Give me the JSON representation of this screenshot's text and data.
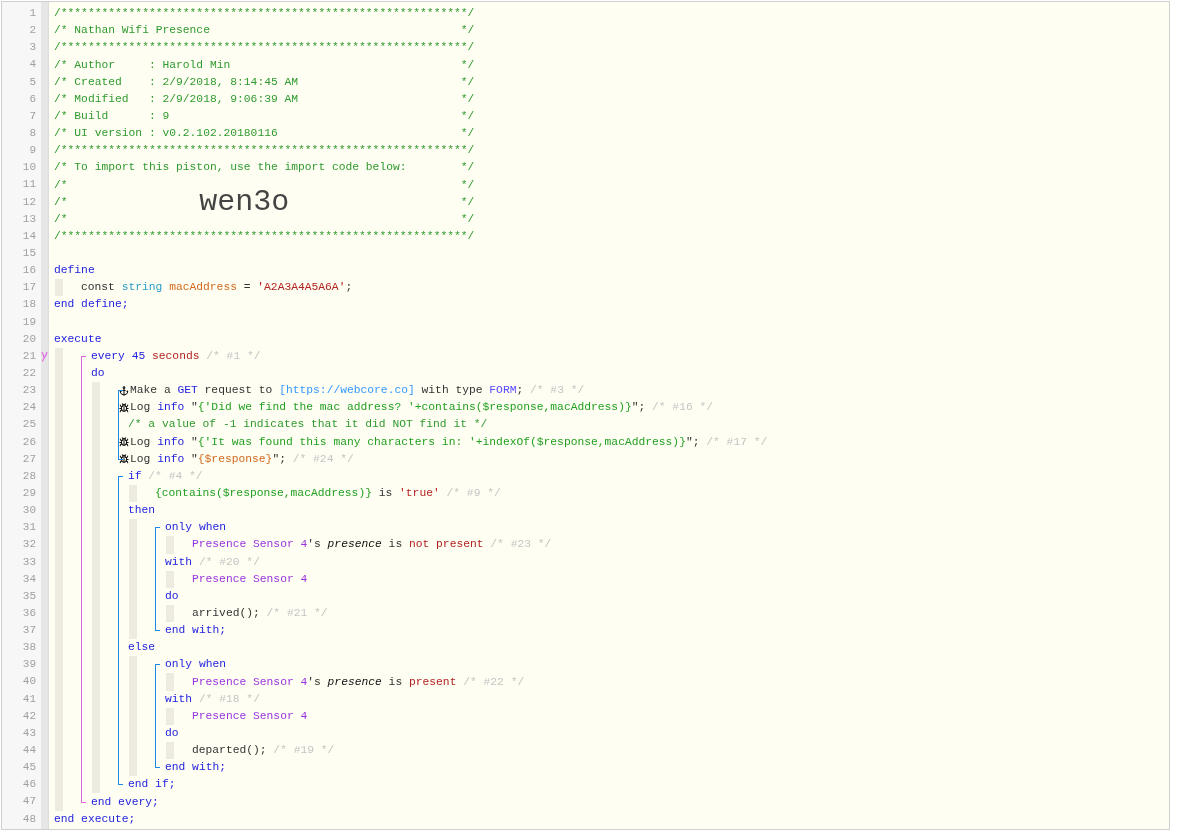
{
  "editor": {
    "lines": [
      {
        "kind": "line",
        "number": "1",
        "marked": false,
        "tokens": [
          {
            "text": "/************************************************************/",
            "kind": "comment"
          }
        ]
      },
      {
        "kind": "line",
        "number": "2",
        "marked": false,
        "tokens": [
          {
            "text": "/* Nathan Wifi Presence",
            "kind": "comment"
          },
          {
            "text": "*/",
            "kind": "comment_close"
          }
        ]
      },
      {
        "kind": "line",
        "number": "3",
        "marked": false,
        "tokens": [
          {
            "text": "/************************************************************/",
            "kind": "comment"
          }
        ]
      },
      {
        "kind": "line",
        "number": "4",
        "marked": false,
        "tokens": [
          {
            "text": "/* Author     : Harold Min",
            "kind": "comment"
          },
          {
            "text": "*/",
            "kind": "comment_close"
          }
        ]
      },
      {
        "kind": "line",
        "number": "5",
        "marked": false,
        "tokens": [
          {
            "text": "/* Created    : 2/9/2018, 8:14:45 AM",
            "kind": "comment"
          },
          {
            "text": "*/",
            "kind": "comment_close"
          }
        ]
      },
      {
        "kind": "line",
        "number": "6",
        "marked": false,
        "tokens": [
          {
            "text": "/* Modified   : 2/9/2018, 9:06:39 AM",
            "kind": "comment"
          },
          {
            "text": "*/",
            "kind": "comment_close"
          }
        ]
      },
      {
        "kind": "line",
        "number": "7",
        "marked": false,
        "tokens": [
          {
            "text": "/* Build      : 9",
            "kind": "comment"
          },
          {
            "text": "*/",
            "kind": "comment_close"
          }
        ]
      },
      {
        "kind": "line",
        "number": "8",
        "marked": false,
        "tokens": [
          {
            "text": "/* UI version : v0.2.102.20180116",
            "kind": "comment"
          },
          {
            "text": "*/",
            "kind": "comment_close"
          }
        ]
      },
      {
        "kind": "line",
        "number": "9",
        "marked": false,
        "tokens": [
          {
            "text": "/************************************************************/",
            "kind": "comment"
          }
        ]
      },
      {
        "kind": "line",
        "number": "10",
        "marked": false,
        "tokens": [
          {
            "text": "/* To import this piston, use the import code below:",
            "kind": "comment"
          },
          {
            "text": "*/",
            "kind": "comment_close"
          }
        ]
      },
      {
        "kind": "line",
        "number": "11",
        "marked": false,
        "tokens": [
          {
            "text": "/*",
            "kind": "comment"
          },
          {
            "text": "*/",
            "kind": "comment_close"
          }
        ]
      },
      {
        "kind": "line",
        "number": "12",
        "marked": false,
        "tokens": [
          {
            "text": "/*",
            "kind": "comment"
          },
          {
            "text": "wen3o",
            "kind": "import_code"
          },
          {
            "text": "*/",
            "kind": "comment_close"
          }
        ]
      },
      {
        "kind": "line",
        "number": "13",
        "marked": false,
        "tokens": [
          {
            "text": "/*",
            "kind": "comment"
          },
          {
            "text": "*/",
            "kind": "comment_close"
          }
        ]
      },
      {
        "kind": "line",
        "number": "14",
        "marked": false,
        "tokens": [
          {
            "text": "/************************************************************/",
            "kind": "comment"
          }
        ]
      },
      {
        "kind": "line",
        "number": "15",
        "marked": false
      },
      {
        "kind": "line",
        "number": "16",
        "marked": false,
        "tokens": [
          {
            "text": "define",
            "kind": "keyword"
          }
        ],
        "children": [
          {
            "kind": "line",
            "number": "17",
            "marked": false,
            "tokens": [
              {
                "text": "const ",
                "kind": "plain"
              },
              {
                "text": "string ",
                "kind": "type"
              },
              {
                "text": "macAddress",
                "kind": "variable"
              },
              {
                "text": " = ",
                "kind": "plain"
              },
              {
                "text": "'A2A3A4A5A6A'",
                "kind": "string"
              },
              {
                "text": ";",
                "kind": "plain"
              }
            ]
          }
        ]
      },
      {
        "kind": "line",
        "number": "18",
        "marked": false,
        "tokens": [
          {
            "text": "end define;",
            "kind": "keyword"
          }
        ]
      },
      {
        "kind": "line",
        "number": "19",
        "marked": false
      },
      {
        "kind": "line",
        "number": "20",
        "marked": false,
        "tokens": [
          {
            "text": "execute",
            "kind": "keyword"
          }
        ],
        "children": [
          {
            "kind": "block",
            "color": "#dd66dd",
            "lines": [
              {
                "kind": "line",
                "number": "21",
                "marked": true,
                "tokens": [
                  {
                    "text": "every ",
                    "kind": "keyword"
                  },
                  {
                    "text": "45 ",
                    "kind": "number"
                  },
                  {
                    "text": "seconds ",
                    "kind": "unit"
                  },
                  {
                    "text": "/* #1 */",
                    "kind": "note"
                  }
                ]
              },
              {
                "kind": "line",
                "number": "22",
                "marked": false,
                "tokens": [
                  {
                    "text": "do",
                    "kind": "keyword"
                  }
                ],
                "children": [
                  {
                    "kind": "block",
                    "color": "#1e88e5",
                    "lines": [
                      {
                        "kind": "request",
                        "number": "23",
                        "marked": false,
                        "tokens": [
                          {
                            "text": "Make a ",
                            "kind": "plain"
                          },
                          {
                            "text": "GET",
                            "kind": "keyword"
                          },
                          {
                            "text": " request to ",
                            "kind": "plain"
                          },
                          {
                            "text": "[https://webcore.co]",
                            "kind": "link"
                          },
                          {
                            "text": " with type ",
                            "kind": "plain"
                          },
                          {
                            "text": "FORM",
                            "kind": "option"
                          },
                          {
                            "text": "; ",
                            "kind": "plain"
                          },
                          {
                            "text": "/* #3 */",
                            "kind": "note"
                          }
                        ]
                      },
                      {
                        "kind": "log",
                        "number": "24",
                        "marked": false,
                        "tokens": [
                          {
                            "text": "Log ",
                            "kind": "plain"
                          },
                          {
                            "text": "info ",
                            "kind": "keyword"
                          },
                          {
                            "text": "\"",
                            "kind": "plain"
                          },
                          {
                            "text": "{'Did we find the mac address? '+contains($response,macAddress)}",
                            "kind": "expression"
                          },
                          {
                            "text": "\"; ",
                            "kind": "plain"
                          },
                          {
                            "text": "/* #16 */",
                            "kind": "note"
                          }
                        ]
                      },
                      {
                        "kind": "line",
                        "number": "25",
                        "marked": false,
                        "tokens": [
                          {
                            "text": "/* a value of -1 indicates that it did NOT find it */",
                            "kind": "comment"
                          }
                        ]
                      },
                      {
                        "kind": "log",
                        "number": "26",
                        "marked": false,
                        "tokens": [
                          {
                            "text": "Log ",
                            "kind": "plain"
                          },
                          {
                            "text": "info ",
                            "kind": "keyword"
                          },
                          {
                            "text": "\"",
                            "kind": "plain"
                          },
                          {
                            "text": "{'It was found this many characters in: '+indexOf($response,macAddress)}",
                            "kind": "expression"
                          },
                          {
                            "text": "\"; ",
                            "kind": "plain"
                          },
                          {
                            "text": "/* #17 */",
                            "kind": "note"
                          }
                        ]
                      },
                      {
                        "kind": "log",
                        "number": "27",
                        "marked": false,
                        "tokens": [
                          {
                            "text": "Log ",
                            "kind": "plain"
                          },
                          {
                            "text": "info ",
                            "kind": "keyword"
                          },
                          {
                            "text": "\"",
                            "kind": "plain"
                          },
                          {
                            "text": "{$response}",
                            "kind": "variable"
                          },
                          {
                            "text": "\"; ",
                            "kind": "plain"
                          },
                          {
                            "text": "/* #24 */",
                            "kind": "note"
                          }
                        ]
                      }
                    ]
                  },
                  {
                    "kind": "block",
                    "color": "#1e88e5",
                    "lines": [
                      {
                        "kind": "line",
                        "number": "28",
                        "marked": false,
                        "tokens": [
                          {
                            "text": "if ",
                            "kind": "keyword"
                          },
                          {
                            "text": "/* #4 */",
                            "kind": "note"
                          }
                        ],
                        "children": [
                          {
                            "kind": "line",
                            "number": "29",
                            "marked": false,
                            "tokens": [
                              {
                                "text": "{contains($response,macAddress)}",
                                "kind": "expression"
                              },
                              {
                                "text": " is ",
                                "kind": "plain"
                              },
                              {
                                "text": "'true' ",
                                "kind": "string"
                              },
                              {
                                "text": "/* #9 */",
                                "kind": "note"
                              }
                            ]
                          }
                        ]
                      },
                      {
                        "kind": "line",
                        "number": "30",
                        "marked": false,
                        "tokens": [
                          {
                            "text": "then",
                            "kind": "keyword"
                          }
                        ],
                        "children": [
                          {
                            "kind": "block",
                            "color": "#1e88e5",
                            "lines": [
                              {
                                "kind": "line",
                                "number": "31",
                                "marked": false,
                                "tokens": [
                                  {
                                    "text": "only when",
                                    "kind": "keyword"
                                  }
                                ],
                                "children": [
                                  {
                                    "kind": "line",
                                    "number": "32",
                                    "marked": false,
                                    "tokens": [
                                      {
                                        "text": "Presence Sensor 4",
                                        "kind": "device"
                                      },
                                      {
                                        "text": "'s ",
                                        "kind": "plain"
                                      },
                                      {
                                        "text": "presence",
                                        "kind": "attribute"
                                      },
                                      {
                                        "text": " is ",
                                        "kind": "plain"
                                      },
                                      {
                                        "text": "not present ",
                                        "kind": "string"
                                      },
                                      {
                                        "text": "/* #23 */",
                                        "kind": "note"
                                      }
                                    ]
                                  }
                                ]
                              },
                              {
                                "kind": "line",
                                "number": "33",
                                "marked": false,
                                "tokens": [
                                  {
                                    "text": "with ",
                                    "kind": "keyword"
                                  },
                                  {
                                    "text": "/* #20 */",
                                    "kind": "note"
                                  }
                                ],
                                "children": [
                                  {
                                    "kind": "line",
                                    "number": "34",
                                    "marked": false,
                                    "tokens": [
                                      {
                                        "text": "Presence Sensor 4",
                                        "kind": "device"
                                      }
                                    ]
                                  }
                                ]
                              },
                              {
                                "kind": "line",
                                "number": "35",
                                "marked": false,
                                "tokens": [
                                  {
                                    "text": "do",
                                    "kind": "keyword"
                                  }
                                ],
                                "children": [
                                  {
                                    "kind": "line",
                                    "number": "36",
                                    "marked": false,
                                    "tokens": [
                                      {
                                        "text": "arrived(); ",
                                        "kind": "plain"
                                      },
                                      {
                                        "text": "/* #21 */",
                                        "kind": "note"
                                      }
                                    ]
                                  }
                                ]
                              },
                              {
                                "kind": "line",
                                "number": "37",
                                "marked": false,
                                "tokens": [
                                  {
                                    "text": "end with;",
                                    "kind": "keyword"
                                  }
                                ]
                              }
                            ]
                          }
                        ]
                      },
                      {
                        "kind": "line",
                        "number": "38",
                        "marked": false,
                        "tokens": [
                          {
                            "text": "else",
                            "kind": "keyword"
                          }
                        ],
                        "children": [
                          {
                            "kind": "block",
                            "color": "#1e88e5",
                            "lines": [
                              {
                                "kind": "line",
                                "number": "39",
                                "marked": false,
                                "tokens": [
                                  {
                                    "text": "only when",
                                    "kind": "keyword"
                                  }
                                ],
                                "children": [
                                  {
                                    "kind": "line",
                                    "number": "40",
                                    "marked": false,
                                    "tokens": [
                                      {
                                        "text": "Presence Sensor 4",
                                        "kind": "device"
                                      },
                                      {
                                        "text": "'s ",
                                        "kind": "plain"
                                      },
                                      {
                                        "text": "presence",
                                        "kind": "attribute"
                                      },
                                      {
                                        "text": " is ",
                                        "kind": "plain"
                                      },
                                      {
                                        "text": "present ",
                                        "kind": "string"
                                      },
                                      {
                                        "text": "/* #22 */",
                                        "kind": "note"
                                      }
                                    ]
                                  }
                                ]
                              },
                              {
                                "kind": "line",
                                "number": "41",
                                "marked": false,
                                "tokens": [
                                  {
                                    "text": "with ",
                                    "kind": "keyword"
                                  },
                                  {
                                    "text": "/* #18 */",
                                    "kind": "note"
                                  }
                                ],
                                "children": [
                                  {
                                    "kind": "line",
                                    "number": "42",
                                    "marked": false,
                                    "tokens": [
                                      {
                                        "text": "Presence Sensor 4",
                                        "kind": "device"
                                      }
                                    ]
                                  }
                                ]
                              },
                              {
                                "kind": "line",
                                "number": "43",
                                "marked": false,
                                "tokens": [
                                  {
                                    "text": "do",
                                    "kind": "keyword"
                                  }
                                ],
                                "children": [
                                  {
                                    "kind": "line",
                                    "number": "44",
                                    "marked": false,
                                    "tokens": [
                                      {
                                        "text": "departed(); ",
                                        "kind": "plain"
                                      },
                                      {
                                        "text": "/* #19 */",
                                        "kind": "note"
                                      }
                                    ]
                                  }
                                ]
                              },
                              {
                                "kind": "line",
                                "number": "45",
                                "marked": false,
                                "tokens": [
                                  {
                                    "text": "end with;",
                                    "kind": "keyword"
                                  }
                                ]
                              }
                            ]
                          }
                        ]
                      },
                      {
                        "kind": "line",
                        "number": "46",
                        "marked": false,
                        "tokens": [
                          {
                            "text": "end if;",
                            "kind": "keyword"
                          }
                        ]
                      }
                    ]
                  }
                ]
              },
              {
                "kind": "line",
                "number": "47",
                "marked": false,
                "tokens": [
                  {
                    "text": "end every;",
                    "kind": "keyword"
                  }
                ]
              }
            ]
          }
        ]
      },
      {
        "kind": "line",
        "number": "48",
        "marked": false,
        "tokens": [
          {
            "text": "end execute;",
            "kind": "keyword"
          }
        ]
      }
    ]
  }
}
